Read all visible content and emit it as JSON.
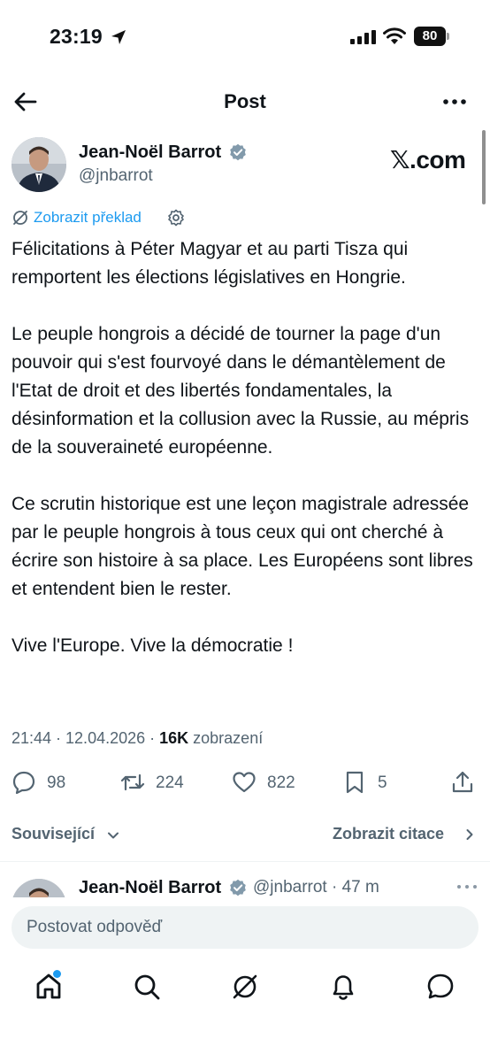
{
  "status_bar": {
    "time": "23:19",
    "battery": "80",
    "icons": [
      "location-arrow-icon",
      "cellular-signal-icon",
      "wifi-icon",
      "battery-icon"
    ]
  },
  "header": {
    "title": "Post",
    "back_icon": "arrow-left-icon",
    "more_icon": "more-horizontal-icon"
  },
  "author": {
    "name": "Jean-Noël Barrot",
    "handle": "@jnbarrot",
    "verified_icon": "verified-badge-icon"
  },
  "watermark": "𝕏.com",
  "translate": {
    "label": "Zobrazit překlad",
    "icon": "grok-icon",
    "settings_icon": "gear-icon"
  },
  "tweet": {
    "paragraphs": [
      "Félicitations à Péter Magyar et au parti Tisza qui remportent les élections législatives en Hongrie.",
      "Le peuple hongrois a décidé de tourner la page d'un pouvoir qui s'est fourvoyé dans le démantèlement de l'Etat de droit et des libertés fondamentales, la désinformation et la collusion avec la Russie, au mépris de la souveraineté européenne.",
      "Ce scrutin historique est une leçon magistrale adressée par le peuple hongrois à tous ceux qui ont cherché à écrire son histoire à sa place. Les Européens sont libres et entendent bien le rester.",
      "Vive l'Europe. Vive la démocratie !"
    ],
    "timestamp": "21:44 · 12.04.2026 · ",
    "views_count": "16K",
    "views_label": " zobrazení"
  },
  "actions": {
    "replies": "98",
    "reposts": "224",
    "likes": "822",
    "bookmarks": "5",
    "icons": [
      "reply-icon",
      "repost-icon",
      "like-icon",
      "bookmark-icon",
      "share-icon"
    ]
  },
  "related": {
    "left_label": "Související",
    "right_label": "Zobrazit citace"
  },
  "reply_preview": {
    "name": "Jean-Noël Barrot",
    "handle": "@jnbarrot · 47 m"
  },
  "reply_bar": {
    "placeholder": "Postovat odpověď"
  },
  "tab_bar": {
    "tabs": [
      "home-icon",
      "search-icon",
      "grok-icon",
      "notifications-icon",
      "messages-icon"
    ]
  },
  "colors": {
    "accent": "#1d9bf0",
    "text": "#0f1419",
    "secondary": "#536471",
    "input_bg": "#eff3f4"
  }
}
